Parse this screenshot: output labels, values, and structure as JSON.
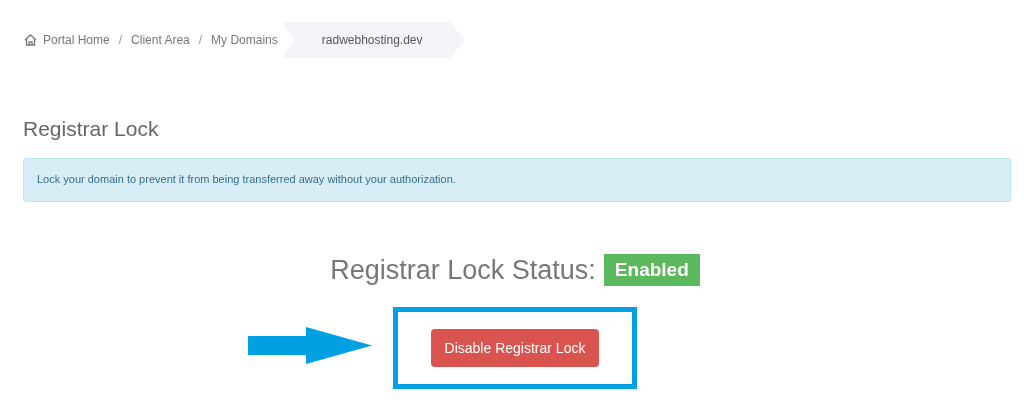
{
  "breadcrumb": [
    {
      "label": "Portal Home",
      "selected": false
    },
    {
      "label": "Client Area",
      "selected": false
    },
    {
      "label": "My Domains",
      "selected": false
    },
    {
      "label": "radwebhosting.dev",
      "selected": true
    }
  ],
  "separator": "/",
  "heading": "Registrar Lock",
  "alert": "Lock your domain to prevent it from being transferred away without your authorization.",
  "status": {
    "label": "Registrar Lock Status:",
    "badge": "Enabled",
    "enabled": true
  },
  "button": "Disable Registrar Lock"
}
